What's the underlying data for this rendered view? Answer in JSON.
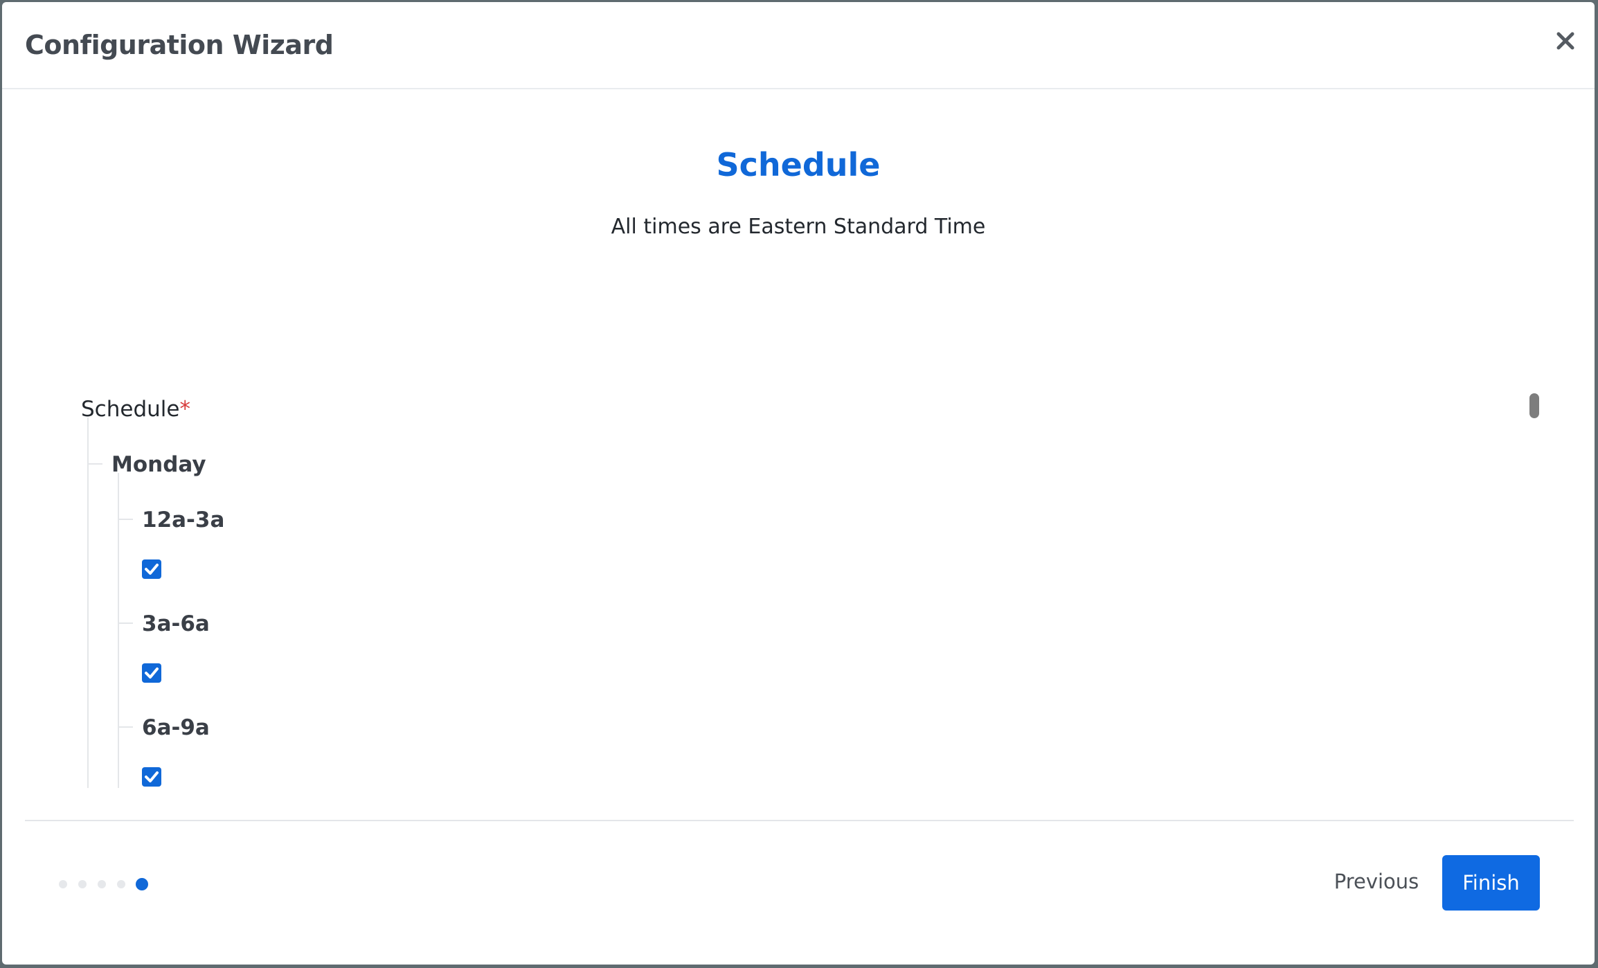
{
  "modal": {
    "title": "Configuration Wizard",
    "close_icon": "close-icon"
  },
  "step": {
    "title": "Schedule",
    "subtitle": "All times are Eastern Standard Time"
  },
  "schedule": {
    "label": "Schedule",
    "required_mark": "*",
    "days": [
      {
        "name": "Monday",
        "slots": [
          {
            "label": "12a-3a",
            "checked": true
          },
          {
            "label": "3a-6a",
            "checked": true
          },
          {
            "label": "6a-9a",
            "checked": true
          }
        ]
      }
    ]
  },
  "progress": {
    "total_steps": 5,
    "current_step": 5
  },
  "footer": {
    "previous_label": "Previous",
    "finish_label": "Finish"
  },
  "colors": {
    "accent": "#1068d8",
    "required": "#d73a3a"
  }
}
